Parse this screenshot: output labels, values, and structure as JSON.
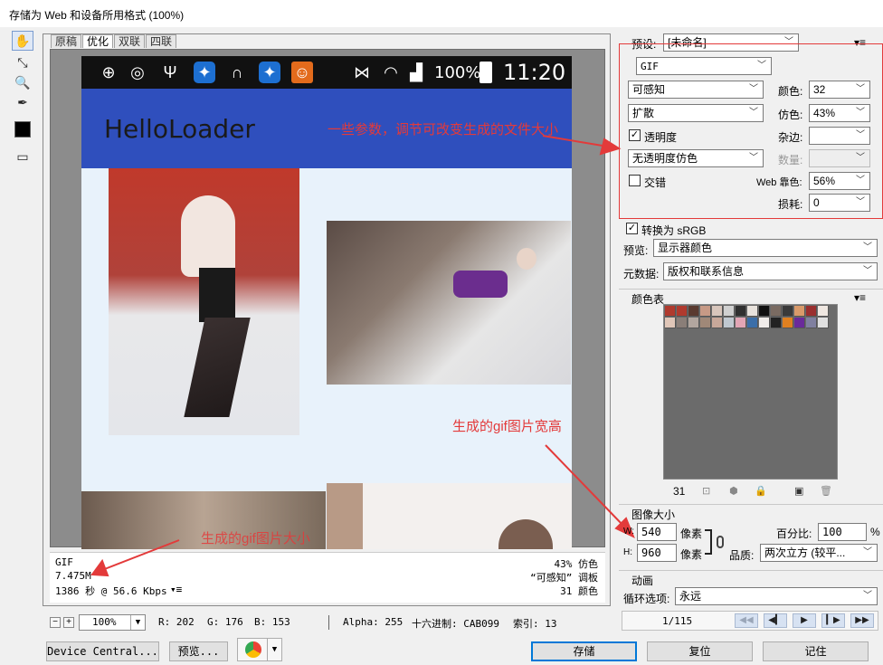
{
  "window": {
    "title": "存储为 Web 和设备所用格式 (100%)"
  },
  "toolbar": {
    "tools": [
      "hand-tool-icon",
      "slice-select-icon",
      "zoom-icon",
      "eyedropper-icon",
      "color-swatch",
      "toggle-slices-icon"
    ]
  },
  "view_tabs": [
    "原稿",
    "优化",
    "双联",
    "四联"
  ],
  "preview": {
    "statusbar": {
      "battery": "100%",
      "time": "11:20"
    },
    "app_title": "HelloLoader"
  },
  "annotations": {
    "params": "一些参数，调节可改变生成的文件大小",
    "dimensions": "生成的gif图片宽高",
    "filesize": "生成的gif图片大小"
  },
  "info": {
    "format": "GIF",
    "size": "7.475M",
    "time": "1386 秒 @ 56.6 Kbps",
    "dither_pct": "43% 仿色",
    "palette": "“可感知” 调板",
    "colors": "31 颜色"
  },
  "bottom_bar": {
    "zoom": "100%",
    "r": "R: 202",
    "g": "G: 176",
    "b": "B: 153",
    "alpha": "Alpha: 255",
    "hex": "十六进制: CAB099",
    "index": "索引: 13"
  },
  "buttons": {
    "device_central": "Device Central...",
    "preview": "预览...",
    "save": "存储",
    "reset": "复位",
    "remember": "记住"
  },
  "settings": {
    "preset_label": "预设:",
    "preset_value": "[未命名]",
    "format": "GIF",
    "reduction": "可感知",
    "colors_label": "颜色:",
    "colors_value": "32",
    "dither_algo": "扩散",
    "dither_label": "仿色:",
    "dither_value": "43%",
    "transparency_label": "透明度",
    "matte_label": "杂边:",
    "transparency_dither": "无透明度仿色",
    "amount_label": "数量:",
    "interlaced_label": "交错",
    "web_snap_label": "Web 靠色:",
    "web_snap_value": "56%",
    "lossy_label": "损耗:",
    "lossy_value": "0",
    "convert_srgb_label": "转换为 sRGB",
    "preview_label": "预览:",
    "preview_value": "显示器颜色",
    "metadata_label": "元数据:",
    "metadata_value": "版权和联系信息"
  },
  "color_table": {
    "title": "颜色表",
    "count": "31",
    "swatches": [
      "#b03a2e",
      "#b03a2e",
      "#5a3a30",
      "#c79a86",
      "#d8c6bc",
      "#d0d0d0",
      "#303030",
      "#e8e2dc",
      "#111111",
      "#7a6b62",
      "#3a3a3a",
      "#d99a6a",
      "#9a2f2f",
      "#efe7e1",
      "#e0c6b8",
      "#8a7e78",
      "#b2a69f",
      "#a08878",
      "#c8a89a",
      "#c0c8d0",
      "#e2a5b5",
      "#3b6ea8",
      "#f0ecea",
      "#222222",
      "#e08020",
      "#6a2a9a",
      "#8080a0",
      "#e0e0e0"
    ]
  },
  "image_size": {
    "title": "图像大小",
    "w_label": "W:",
    "width": "540",
    "h_label": "H:",
    "height": "960",
    "unit": "像素",
    "percent_label": "百分比:",
    "percent": "100",
    "percent_sign": "%",
    "quality_label": "品质:",
    "quality_value": "两次立方 (较平..."
  },
  "animation": {
    "title": "动画",
    "loop_label": "循环选项:",
    "loop_value": "永远",
    "frame": "1/115"
  }
}
